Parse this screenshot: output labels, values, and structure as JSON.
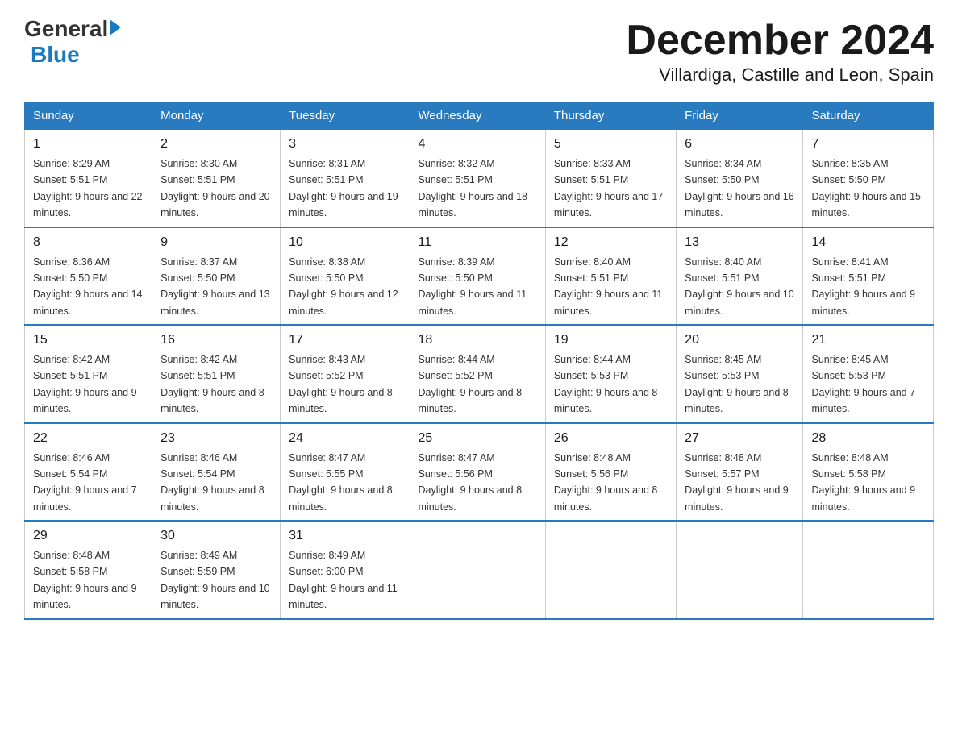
{
  "header": {
    "logo_general": "General",
    "logo_blue": "Blue",
    "title": "December 2024",
    "subtitle": "Villardiga, Castille and Leon, Spain"
  },
  "days_of_week": [
    "Sunday",
    "Monday",
    "Tuesday",
    "Wednesday",
    "Thursday",
    "Friday",
    "Saturday"
  ],
  "weeks": [
    [
      {
        "day": "1",
        "sunrise": "8:29 AM",
        "sunset": "5:51 PM",
        "daylight": "9 hours and 22 minutes."
      },
      {
        "day": "2",
        "sunrise": "8:30 AM",
        "sunset": "5:51 PM",
        "daylight": "9 hours and 20 minutes."
      },
      {
        "day": "3",
        "sunrise": "8:31 AM",
        "sunset": "5:51 PM",
        "daylight": "9 hours and 19 minutes."
      },
      {
        "day": "4",
        "sunrise": "8:32 AM",
        "sunset": "5:51 PM",
        "daylight": "9 hours and 18 minutes."
      },
      {
        "day": "5",
        "sunrise": "8:33 AM",
        "sunset": "5:51 PM",
        "daylight": "9 hours and 17 minutes."
      },
      {
        "day": "6",
        "sunrise": "8:34 AM",
        "sunset": "5:50 PM",
        "daylight": "9 hours and 16 minutes."
      },
      {
        "day": "7",
        "sunrise": "8:35 AM",
        "sunset": "5:50 PM",
        "daylight": "9 hours and 15 minutes."
      }
    ],
    [
      {
        "day": "8",
        "sunrise": "8:36 AM",
        "sunset": "5:50 PM",
        "daylight": "9 hours and 14 minutes."
      },
      {
        "day": "9",
        "sunrise": "8:37 AM",
        "sunset": "5:50 PM",
        "daylight": "9 hours and 13 minutes."
      },
      {
        "day": "10",
        "sunrise": "8:38 AM",
        "sunset": "5:50 PM",
        "daylight": "9 hours and 12 minutes."
      },
      {
        "day": "11",
        "sunrise": "8:39 AM",
        "sunset": "5:50 PM",
        "daylight": "9 hours and 11 minutes."
      },
      {
        "day": "12",
        "sunrise": "8:40 AM",
        "sunset": "5:51 PM",
        "daylight": "9 hours and 11 minutes."
      },
      {
        "day": "13",
        "sunrise": "8:40 AM",
        "sunset": "5:51 PM",
        "daylight": "9 hours and 10 minutes."
      },
      {
        "day": "14",
        "sunrise": "8:41 AM",
        "sunset": "5:51 PM",
        "daylight": "9 hours and 9 minutes."
      }
    ],
    [
      {
        "day": "15",
        "sunrise": "8:42 AM",
        "sunset": "5:51 PM",
        "daylight": "9 hours and 9 minutes."
      },
      {
        "day": "16",
        "sunrise": "8:42 AM",
        "sunset": "5:51 PM",
        "daylight": "9 hours and 8 minutes."
      },
      {
        "day": "17",
        "sunrise": "8:43 AM",
        "sunset": "5:52 PM",
        "daylight": "9 hours and 8 minutes."
      },
      {
        "day": "18",
        "sunrise": "8:44 AM",
        "sunset": "5:52 PM",
        "daylight": "9 hours and 8 minutes."
      },
      {
        "day": "19",
        "sunrise": "8:44 AM",
        "sunset": "5:53 PM",
        "daylight": "9 hours and 8 minutes."
      },
      {
        "day": "20",
        "sunrise": "8:45 AM",
        "sunset": "5:53 PM",
        "daylight": "9 hours and 8 minutes."
      },
      {
        "day": "21",
        "sunrise": "8:45 AM",
        "sunset": "5:53 PM",
        "daylight": "9 hours and 7 minutes."
      }
    ],
    [
      {
        "day": "22",
        "sunrise": "8:46 AM",
        "sunset": "5:54 PM",
        "daylight": "9 hours and 7 minutes."
      },
      {
        "day": "23",
        "sunrise": "8:46 AM",
        "sunset": "5:54 PM",
        "daylight": "9 hours and 8 minutes."
      },
      {
        "day": "24",
        "sunrise": "8:47 AM",
        "sunset": "5:55 PM",
        "daylight": "9 hours and 8 minutes."
      },
      {
        "day": "25",
        "sunrise": "8:47 AM",
        "sunset": "5:56 PM",
        "daylight": "9 hours and 8 minutes."
      },
      {
        "day": "26",
        "sunrise": "8:48 AM",
        "sunset": "5:56 PM",
        "daylight": "9 hours and 8 minutes."
      },
      {
        "day": "27",
        "sunrise": "8:48 AM",
        "sunset": "5:57 PM",
        "daylight": "9 hours and 9 minutes."
      },
      {
        "day": "28",
        "sunrise": "8:48 AM",
        "sunset": "5:58 PM",
        "daylight": "9 hours and 9 minutes."
      }
    ],
    [
      {
        "day": "29",
        "sunrise": "8:48 AM",
        "sunset": "5:58 PM",
        "daylight": "9 hours and 9 minutes."
      },
      {
        "day": "30",
        "sunrise": "8:49 AM",
        "sunset": "5:59 PM",
        "daylight": "9 hours and 10 minutes."
      },
      {
        "day": "31",
        "sunrise": "8:49 AM",
        "sunset": "6:00 PM",
        "daylight": "9 hours and 11 minutes."
      },
      null,
      null,
      null,
      null
    ]
  ]
}
